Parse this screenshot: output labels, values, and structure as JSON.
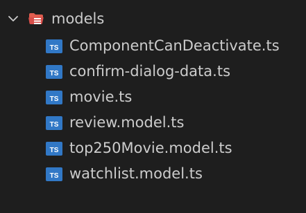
{
  "colors": {
    "background": "#1e1e1e",
    "text": "#cccccc",
    "folder_icon": "#d84f4a",
    "typescript_icon": "#3178c6",
    "chevron": "#cccccc"
  },
  "folder": {
    "label": "models",
    "expanded": true,
    "chevron_icon": "chevron-down-icon",
    "folder_icon": "folder-open-red-icon"
  },
  "files": [
    {
      "label": "ComponentCanDeactivate.ts",
      "icon": "typescript-file-icon",
      "icon_text": "TS"
    },
    {
      "label": "confirm-dialog-data.ts",
      "icon": "typescript-file-icon",
      "icon_text": "TS"
    },
    {
      "label": "movie.ts",
      "icon": "typescript-file-icon",
      "icon_text": "TS"
    },
    {
      "label": "review.model.ts",
      "icon": "typescript-file-icon",
      "icon_text": "TS"
    },
    {
      "label": "top250Movie.model.ts",
      "icon": "typescript-file-icon",
      "icon_text": "TS"
    },
    {
      "label": "watchlist.model.ts",
      "icon": "typescript-file-icon",
      "icon_text": "TS"
    }
  ]
}
